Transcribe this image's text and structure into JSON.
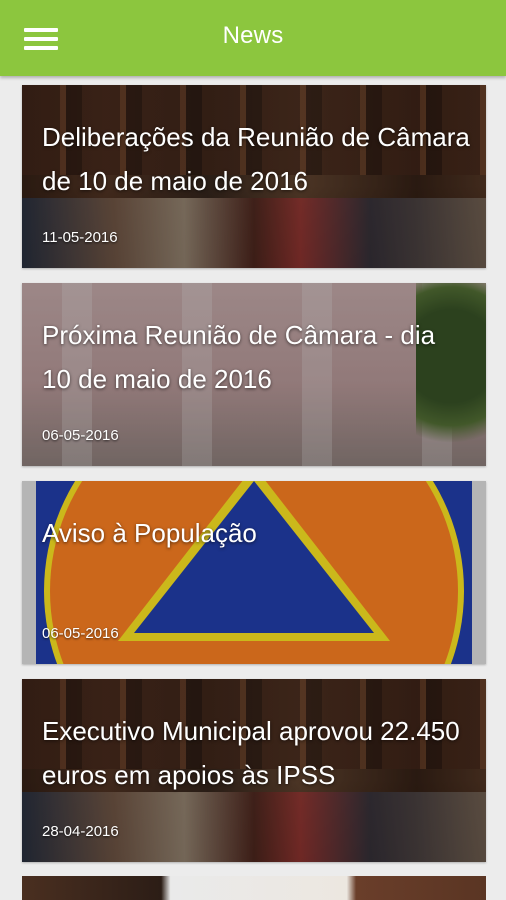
{
  "header": {
    "title": "News"
  },
  "news": [
    {
      "headline": "Deliberações da Reunião de Câmara de 10 de maio de 2016",
      "date": "11-05-2016"
    },
    {
      "headline": "Próxima Reunião de Câmara - dia 10 de maio de 2016",
      "date": "06-05-2016"
    },
    {
      "headline": "Aviso à População",
      "date": "06-05-2016"
    },
    {
      "headline": "Executivo Municipal aprovou 22.450 euros em apoios às IPSS",
      "date": "28-04-2016"
    }
  ],
  "colors": {
    "appbar": "#8cc63e",
    "civil_blue": "#1f3a9e",
    "civil_orange": "#e8761f",
    "civil_yellow": "#e8d21f"
  }
}
